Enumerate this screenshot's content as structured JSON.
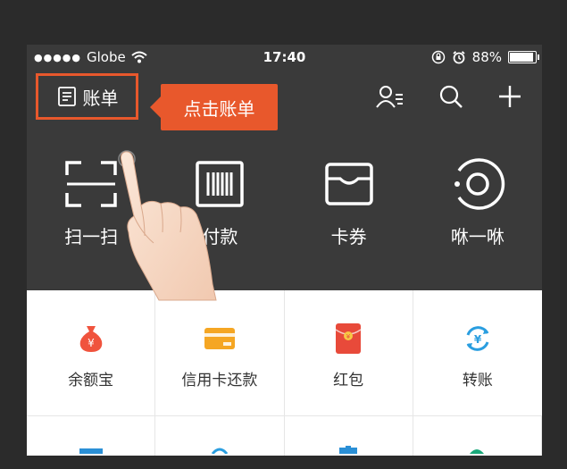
{
  "status_bar": {
    "carrier": "Globe",
    "time": "17:40",
    "battery": "88%",
    "battery_level": 0.88
  },
  "header": {
    "bill_label": "账单",
    "callout": "点击账单",
    "icons": [
      "contacts-icon",
      "search-icon",
      "plus-icon"
    ]
  },
  "quick_actions": [
    {
      "label": "扫一扫",
      "icon": "scan-icon"
    },
    {
      "label": "付款",
      "icon": "barcode-icon"
    },
    {
      "label": "卡券",
      "icon": "wallet-icon"
    },
    {
      "label": "咻一咻",
      "icon": "radar-icon"
    }
  ],
  "grid": [
    {
      "label": "余额宝",
      "icon": "money-bag-icon",
      "color": "#f0533d"
    },
    {
      "label": "信用卡还款",
      "icon": "credit-card-icon",
      "color": "#f5a623"
    },
    {
      "label": "红包",
      "icon": "red-envelope-icon",
      "color": "#e84a3a"
    },
    {
      "label": "转账",
      "icon": "transfer-icon",
      "color": "#2a9ee0"
    }
  ],
  "colors": {
    "accent": "#e8582c",
    "header_bg": "#3a3a3a"
  }
}
